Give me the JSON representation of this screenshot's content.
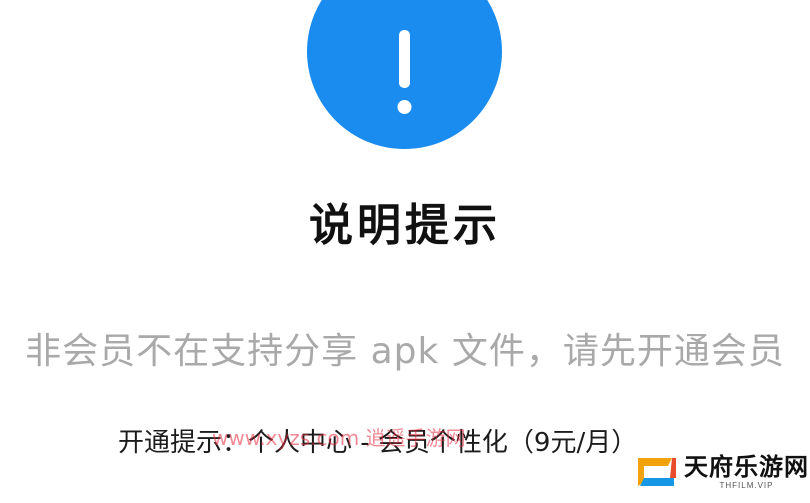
{
  "dialog": {
    "title": "说明提示",
    "message": "非会员不在支持分享 apk 文件，请先开通会员",
    "hint": "开通提示：个人中心 - 会员个性化（9元/月）",
    "icon": "exclamation-icon",
    "accent_color": "#1a8cf0"
  },
  "watermark": {
    "text": "www.xyzs.com 逍遥手游网"
  },
  "logo": {
    "name": "天府乐游网",
    "domain": "THFILM.VIP"
  }
}
